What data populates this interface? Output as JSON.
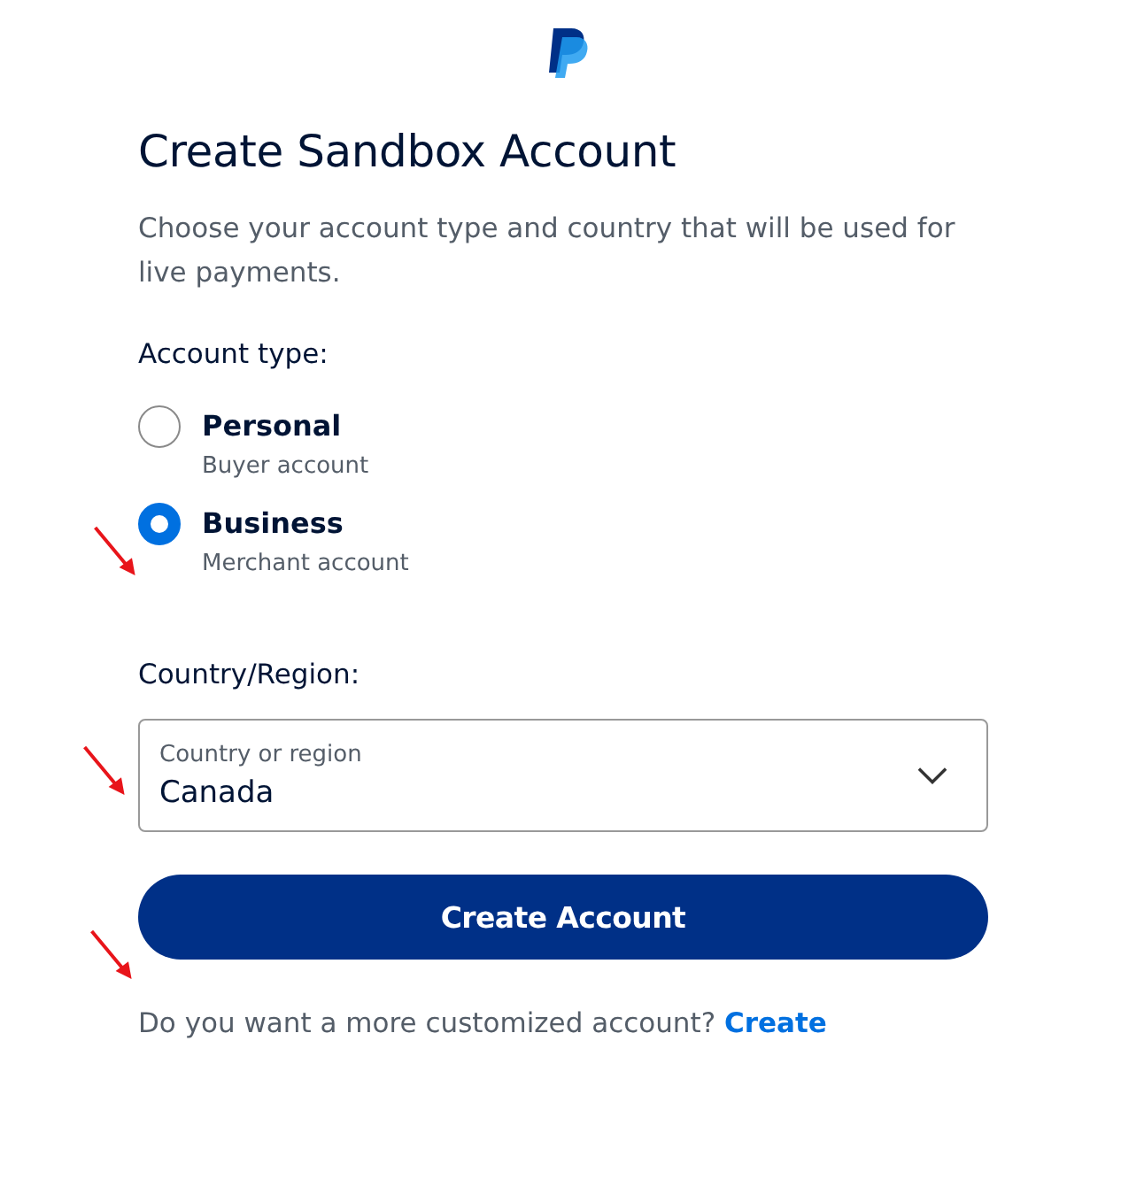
{
  "title": "Create Sandbox Account",
  "description": "Choose your account type and country that will be used for live payments.",
  "account_type": {
    "label": "Account type:",
    "options": [
      {
        "label": "Personal",
        "sublabel": "Buyer account",
        "selected": false
      },
      {
        "label": "Business",
        "sublabel": "Merchant account",
        "selected": true
      }
    ]
  },
  "country": {
    "label": "Country/Region:",
    "field_label": "Country or region",
    "value": "Canada"
  },
  "button": "Create Account",
  "footer": {
    "text": "Do you want a more customized account?",
    "link": "Create"
  }
}
